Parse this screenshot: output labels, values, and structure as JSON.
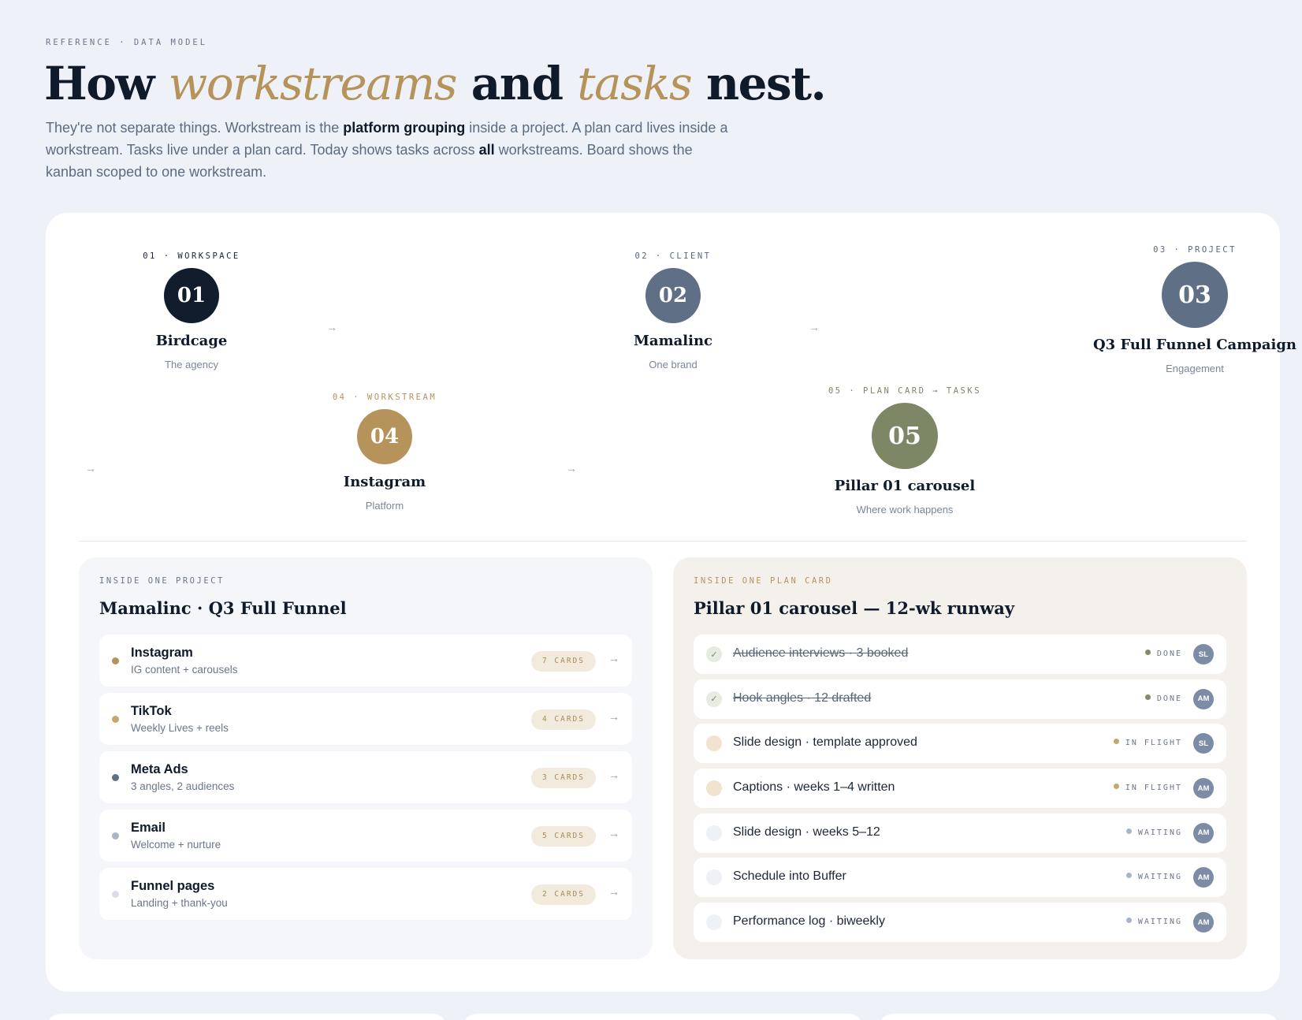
{
  "header": {
    "eyebrow": "REFERENCE · DATA MODEL",
    "title_parts": [
      "How ",
      "workstreams",
      " and ",
      "tasks",
      " nest."
    ],
    "lede": {
      "p1": "They're not separate things. Workstream is the ",
      "b1": "platform grouping",
      "p2": " inside a project. A plan card lives inside a workstream. Tasks live under a plan card. Today shows tasks across ",
      "b2": "all",
      "p3": " workstreams. Board shows the kanban scoped to one workstream."
    }
  },
  "hierarchy": {
    "arrow": "→",
    "nodes": [
      {
        "label": "01 · WORKSPACE",
        "number": "01",
        "name": "Birdcage",
        "sub": "The agency",
        "color": "#111c2d"
      },
      {
        "label": "02 · CLIENT",
        "number": "02",
        "name": "Mamalinc",
        "sub": "One brand",
        "color": "#5e6f86"
      },
      {
        "label": "03 · PROJECT",
        "number": "03",
        "name": "Q3 Full Funnel Campaign",
        "sub": "Engagement",
        "color": "#5e6f86"
      },
      {
        "label": "04 · WORKSTREAM",
        "number": "04",
        "name": "Instagram",
        "sub": "Platform",
        "color": "#b5935b"
      },
      {
        "label": "05 · PLAN CARD → TASKS",
        "number": "05",
        "name": "Pillar 01 carousel",
        "sub": "Where work happens",
        "color": "#7d8765"
      }
    ]
  },
  "project_panel": {
    "label": "INSIDE ONE PROJECT",
    "title": "Mamalinc · Q3 Full Funnel",
    "workstreams": [
      {
        "name": "Instagram",
        "desc": "IG content + carousels",
        "cards": "7 CARDS",
        "dot": "#b5935b"
      },
      {
        "name": "TikTok",
        "desc": "Weekly Lives + reels",
        "cards": "4 CARDS",
        "dot": "#c9a56e"
      },
      {
        "name": "Meta Ads",
        "desc": "3 angles, 2 audiences",
        "cards": "3 CARDS",
        "dot": "#5e6f86"
      },
      {
        "name": "Email",
        "desc": "Welcome + nurture",
        "cards": "5 CARDS",
        "dot": "#a9b4c6"
      },
      {
        "name": "Funnel pages",
        "desc": "Landing + thank-you",
        "cards": "2 CARDS",
        "dot": "#d9dfe9"
      }
    ]
  },
  "plan_panel": {
    "label": "INSIDE ONE PLAN CARD",
    "title": "Pillar 01 carousel — 12-wk runway",
    "tasks": [
      {
        "text": "Audience interviews · 3 booked",
        "status": "DONE",
        "state": "done",
        "avatar": "SL",
        "dot": "#7f8b6b"
      },
      {
        "text": "Hook angles · 12 drafted",
        "status": "DONE",
        "state": "done",
        "avatar": "AM",
        "dot": "#7f8b6b"
      },
      {
        "text": "Slide design · template approved",
        "status": "IN FLIGHT",
        "state": "flight",
        "avatar": "SL",
        "dot": "#c9a56e"
      },
      {
        "text": "Captions · weeks 1–4 written",
        "status": "IN FLIGHT",
        "state": "flight",
        "avatar": "AM",
        "dot": "#c9a56e"
      },
      {
        "text": "Slide design · weeks 5–12",
        "status": "WAITING",
        "state": "wait",
        "avatar": "AM",
        "dot": "#a9b4c6"
      },
      {
        "text": "Schedule into Buffer",
        "status": "WAITING",
        "state": "wait",
        "avatar": "AM",
        "dot": "#a9b4c6"
      },
      {
        "text": "Performance log · biweekly",
        "status": "WAITING",
        "state": "wait",
        "avatar": "AM",
        "dot": "#a9b4c6"
      }
    ]
  }
}
